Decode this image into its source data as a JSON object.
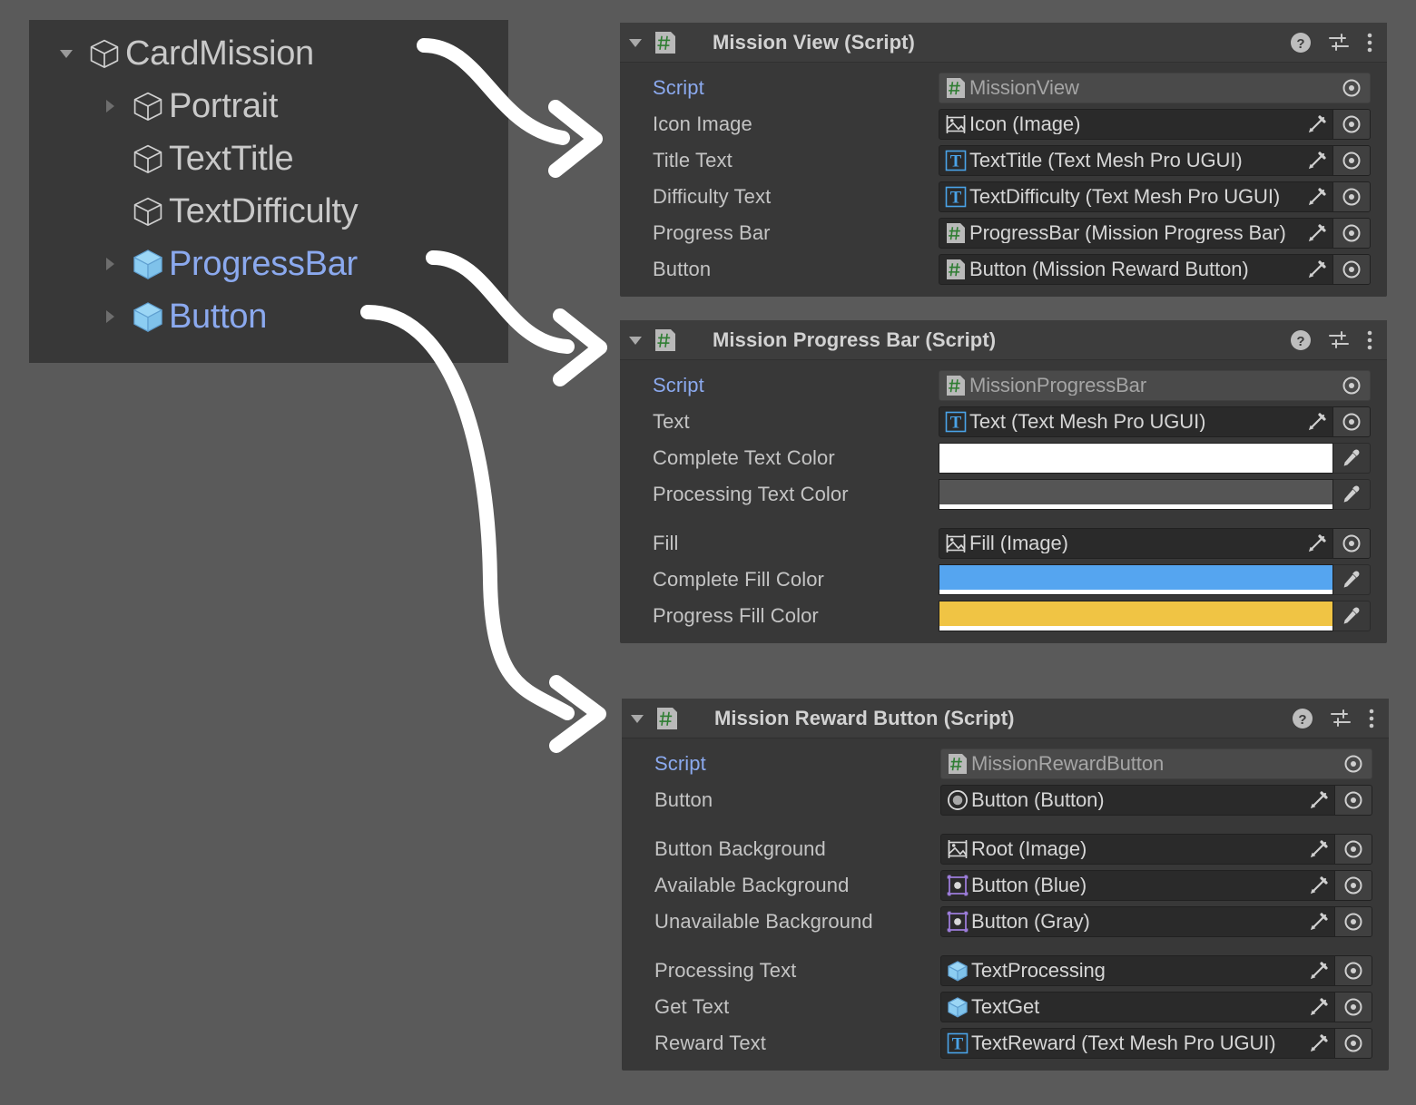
{
  "hierarchy": {
    "rows": [
      {
        "label": "CardMission",
        "indent": 0,
        "twisty": "expanded",
        "icon": "gameobject-cube-icon",
        "style": "normal"
      },
      {
        "label": "Portrait",
        "indent": 1,
        "twisty": "collapsed",
        "icon": "gameobject-cube-icon",
        "style": "normal"
      },
      {
        "label": "TextTitle",
        "indent": 1,
        "twisty": "none",
        "icon": "gameobject-cube-icon",
        "style": "normal"
      },
      {
        "label": "TextDifficulty",
        "indent": 1,
        "twisty": "none",
        "icon": "gameobject-cube-icon",
        "style": "normal"
      },
      {
        "label": "ProgressBar",
        "indent": 1,
        "twisty": "collapsed",
        "icon": "prefab-cube-icon",
        "style": "prefab"
      },
      {
        "label": "Button",
        "indent": 1,
        "twisty": "collapsed",
        "icon": "prefab-cube-icon",
        "style": "prefab"
      }
    ]
  },
  "components": [
    {
      "title": "Mission View (Script)",
      "header_icons": [
        "help-icon",
        "preset-icon",
        "more-menu-icon"
      ],
      "rows": [
        {
          "label": "Script",
          "label_style": "script",
          "type": "object",
          "icon": "script-icon",
          "value": "MissionView",
          "readonly": true,
          "edit": false
        },
        {
          "label": "Icon Image",
          "label_style": "normal",
          "type": "object",
          "icon": "image-icon",
          "value": "Icon (Image)",
          "readonly": false,
          "edit": true
        },
        {
          "label": "Title Text",
          "label_style": "normal",
          "type": "object",
          "icon": "tmp-icon",
          "value": "TextTitle (Text Mesh Pro UGUI)",
          "readonly": false,
          "edit": true
        },
        {
          "label": "Difficulty Text",
          "label_style": "normal",
          "type": "object",
          "icon": "tmp-icon",
          "value": "TextDifficulty (Text Mesh Pro UGUI)",
          "readonly": false,
          "edit": true
        },
        {
          "label": "Progress Bar",
          "label_style": "normal",
          "type": "object",
          "icon": "script-icon",
          "value": "ProgressBar (Mission Progress Bar)",
          "readonly": false,
          "edit": true
        },
        {
          "label": "Button",
          "label_style": "normal",
          "type": "object",
          "icon": "script-icon",
          "value": "Button (Mission Reward Button)",
          "readonly": false,
          "edit": true
        }
      ]
    },
    {
      "title": "Mission Progress Bar (Script)",
      "header_icons": [
        "help-icon",
        "preset-icon",
        "more-menu-icon"
      ],
      "rows": [
        {
          "label": "Script",
          "label_style": "script",
          "type": "object",
          "icon": "script-icon",
          "value": "MissionProgressBar",
          "readonly": true,
          "edit": false
        },
        {
          "label": "Text",
          "label_style": "normal",
          "type": "object",
          "icon": "tmp-icon",
          "value": "Text (Text Mesh Pro UGUI)",
          "readonly": false,
          "edit": true
        },
        {
          "label": "Complete Text Color",
          "label_style": "normal",
          "type": "color",
          "color": "#ffffff",
          "alpha": "#ffffff"
        },
        {
          "label": "Processing Text Color",
          "label_style": "normal",
          "type": "color",
          "color": "#555555",
          "alpha": "#ffffff"
        },
        {
          "type": "spacer"
        },
        {
          "label": "Fill",
          "label_style": "normal",
          "type": "object",
          "icon": "image-icon",
          "value": "Fill (Image)",
          "readonly": false,
          "edit": true
        },
        {
          "label": "Complete Fill Color",
          "label_style": "normal",
          "type": "color",
          "color": "#55a5f0",
          "alpha": "#ffffff"
        },
        {
          "label": "Progress Fill Color",
          "label_style": "normal",
          "type": "color",
          "color": "#f0c444",
          "alpha": "#ffffff"
        }
      ]
    },
    {
      "title": "Mission Reward Button (Script)",
      "header_icons": [
        "help-icon",
        "preset-icon",
        "more-menu-icon"
      ],
      "rows": [
        {
          "label": "Script",
          "label_style": "script",
          "type": "object",
          "icon": "script-icon",
          "value": "MissionRewardButton",
          "readonly": true,
          "edit": false
        },
        {
          "label": "Button",
          "label_style": "normal",
          "type": "object",
          "icon": "button-icon",
          "value": "Button (Button)",
          "readonly": false,
          "edit": true
        },
        {
          "type": "spacer"
        },
        {
          "label": "Button Background",
          "label_style": "normal",
          "type": "object",
          "icon": "image-icon",
          "value": "Root (Image)",
          "readonly": false,
          "edit": true
        },
        {
          "label": "Available Background",
          "label_style": "normal",
          "type": "object",
          "icon": "sprite-icon",
          "value": "Button (Blue)",
          "readonly": false,
          "edit": true
        },
        {
          "label": "Unavailable Background",
          "label_style": "normal",
          "type": "object",
          "icon": "sprite-icon",
          "value": "Button (Gray)",
          "readonly": false,
          "edit": true
        },
        {
          "type": "spacer"
        },
        {
          "label": "Processing Text",
          "label_style": "normal",
          "type": "object",
          "icon": "prefab-cube-icon",
          "value": "TextProcessing",
          "readonly": false,
          "edit": true
        },
        {
          "label": "Get Text",
          "label_style": "normal",
          "type": "object",
          "icon": "prefab-cube-icon",
          "value": "TextGet",
          "readonly": false,
          "edit": true
        },
        {
          "label": "Reward Text",
          "label_style": "normal",
          "type": "object",
          "icon": "tmp-icon",
          "value": "TextReward (Text Mesh Pro UGUI)",
          "readonly": false,
          "edit": true
        }
      ]
    }
  ],
  "annotations": {
    "arrow_color": "#ffffff",
    "arrows": [
      {
        "name": "arrow-cardmission-to-mission-view"
      },
      {
        "name": "arrow-progressbar-to-mission-progress-bar"
      },
      {
        "name": "arrow-button-to-mission-reward-button"
      }
    ]
  },
  "colors": {
    "background": "#5a5a5a",
    "panel": "#383838",
    "panel_header": "#3d3d3d",
    "prefab_blue": "#8ba9ee",
    "complete_fill": "#55a5f0",
    "progress_fill": "#f0c444"
  }
}
